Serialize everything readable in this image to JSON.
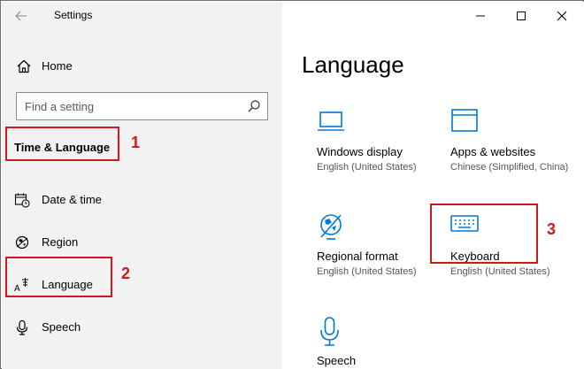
{
  "window": {
    "app_title": "Settings"
  },
  "sidebar": {
    "home_label": "Home",
    "search_placeholder": "Find a setting",
    "section_title": "Time & Language",
    "items": [
      {
        "label": "Date & time",
        "icon": "calendar-clock-icon"
      },
      {
        "label": "Region",
        "icon": "globe-icon"
      },
      {
        "label": "Language",
        "icon": "language-icon"
      },
      {
        "label": "Speech",
        "icon": "microphone-icon"
      }
    ]
  },
  "main": {
    "page_title": "Language",
    "tiles": [
      {
        "title": "Windows display",
        "subtitle": "English (United States)",
        "icon": "monitor-icon"
      },
      {
        "title": "Apps & websites",
        "subtitle": "Chinese (Simplified, China)",
        "icon": "window-icon"
      },
      {
        "title": "Regional format",
        "subtitle": "English (United States)",
        "icon": "globe-format-icon"
      },
      {
        "title": "Keyboard",
        "subtitle": "English (United States)",
        "icon": "keyboard-icon"
      },
      {
        "title": "Speech",
        "subtitle": "",
        "icon": "microphone-icon"
      }
    ]
  },
  "annotations": [
    {
      "number": "1"
    },
    {
      "number": "2"
    },
    {
      "number": "3"
    }
  ],
  "colors": {
    "accent": "#0078d7",
    "annotation": "#d0191e",
    "sidebar_bg": "#f2f2f2"
  }
}
